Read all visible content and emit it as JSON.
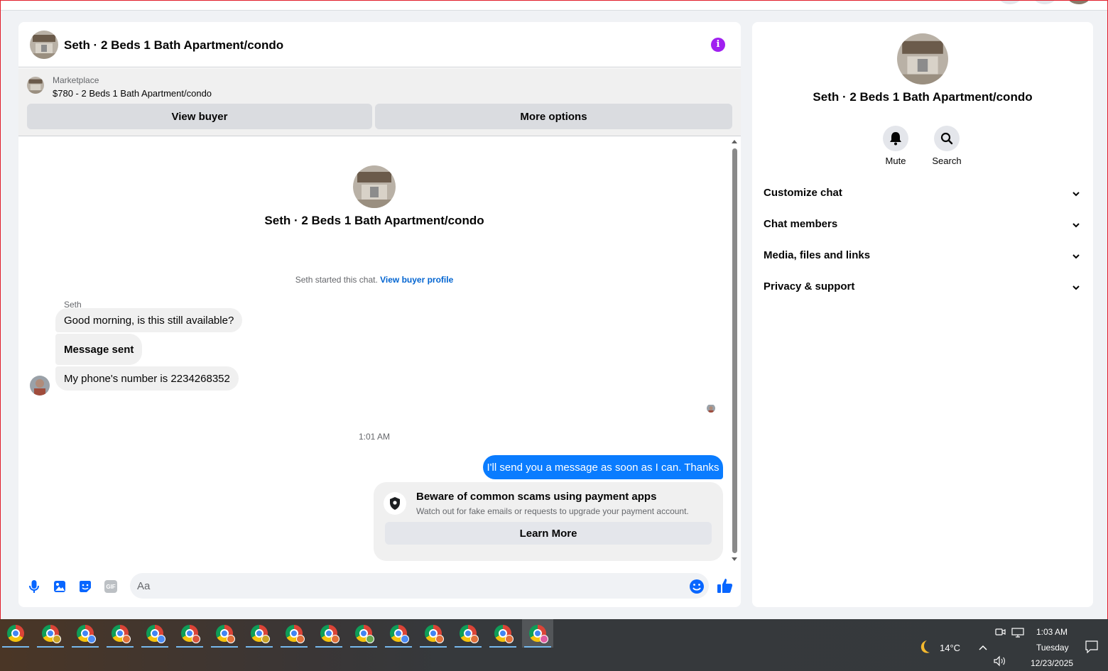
{
  "colors": {
    "accent": "#0a7cff",
    "link": "#0064d1",
    "info": "#a020f0"
  },
  "chat": {
    "title": "Seth · 2 Beds 1 Bath Apartment/condo",
    "marketplace_label": "Marketplace",
    "listing": "$780 - 2 Beds 1 Bath Apartment/condo",
    "view_buyer": "View buyer",
    "more_options": "More options"
  },
  "thread": {
    "title": "Seth · 2 Beds 1 Bath Apartment/condo",
    "started_text": "Seth started this chat.",
    "view_profile": "View buyer profile",
    "sender_name": "Seth",
    "messages_in": [
      "Good morning, is this still available?",
      "Message sent",
      "My phone's number is 2234268352"
    ],
    "timestamp": "1:01 AM",
    "message_out": "I'll send you a message as soon as I can. Thanks",
    "scam_title": "Beware of common scams using payment apps",
    "scam_body": "Watch out for fake emails or requests to upgrade your payment account.",
    "learn_more": "Learn More"
  },
  "composer": {
    "placeholder": "Aa",
    "icons": [
      "microphone-icon",
      "photo-icon",
      "sticker-icon",
      "gif-icon",
      "emoji-icon",
      "thumbs-up-icon"
    ],
    "gif_label": "GIF"
  },
  "right_panel": {
    "title": "Seth · 2 Beds 1 Bath Apartment/condo",
    "mute": "Mute",
    "search": "Search",
    "sections": [
      "Customize chat",
      "Chat members",
      "Media, files and links",
      "Privacy & support"
    ]
  },
  "taskbar": {
    "weather": "14°C",
    "time": "1:03 AM",
    "day": "Tuesday",
    "date": "12/23/2025",
    "profile_colors": [
      "#4c8bf5",
      "#c9a227",
      "#4c8bf5",
      "#e0703a",
      "#4c8bf5",
      "#d8543c",
      "#e0703a",
      "#c9a227",
      "#e0703a",
      "#e0703a",
      "#6aa84f",
      "#4c8bf5",
      "#e0703a",
      "#e0703a",
      "#e0703a",
      "#e05ba0"
    ]
  }
}
